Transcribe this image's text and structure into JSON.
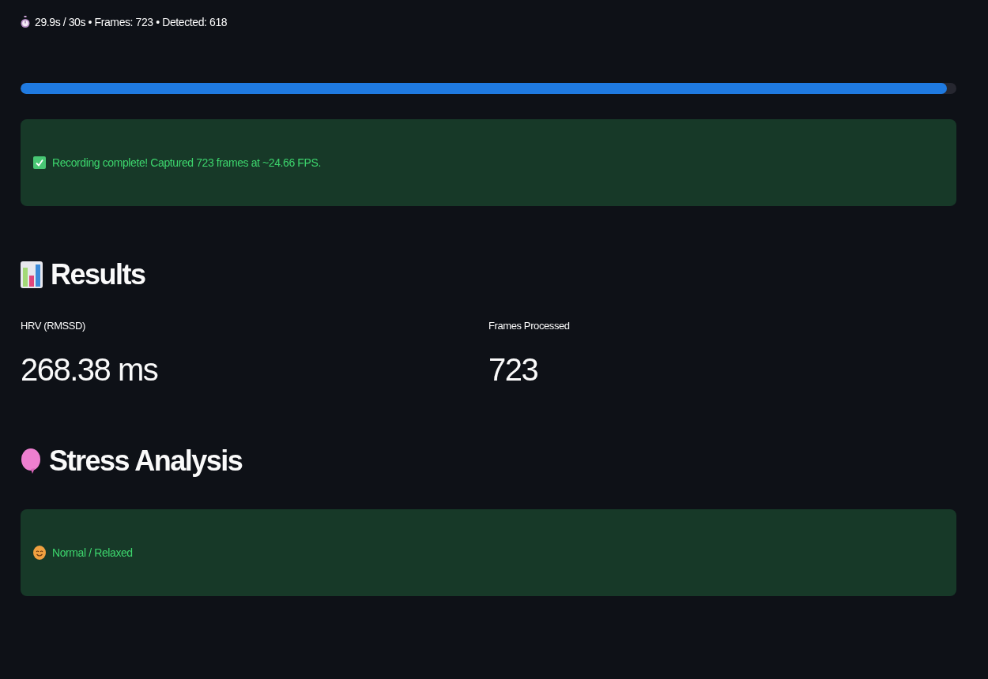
{
  "status": {
    "text": "29.9s / 30s • Frames: 723 • Detected: 618"
  },
  "progress": {
    "level": 0.99
  },
  "success_alert": {
    "text": "Recording complete! Captured 723 frames at ~24.66 FPS."
  },
  "results": {
    "title": "Results",
    "metrics": [
      {
        "label": "HRV (RMSSD)",
        "value": "268.38 ms"
      },
      {
        "label": "Frames Processed",
        "value": "723"
      }
    ]
  },
  "stress": {
    "title": "Stress Analysis",
    "alert": {
      "text": "Normal / Relaxed"
    }
  }
}
